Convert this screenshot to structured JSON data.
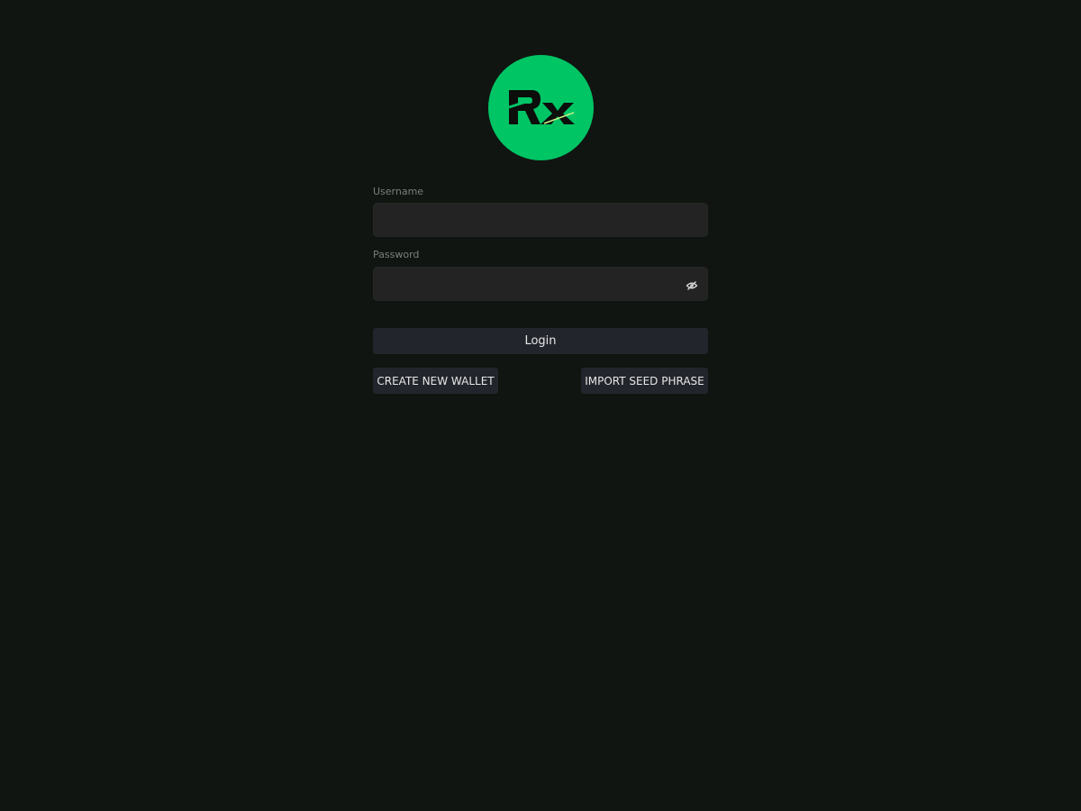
{
  "logo": {
    "text": "Rx",
    "color": "#00c565"
  },
  "form": {
    "username": {
      "label": "Username",
      "value": "",
      "placeholder": ""
    },
    "password": {
      "label": "Password",
      "value": "",
      "placeholder": "",
      "toggle_icon": "eye-slash-icon"
    },
    "login_label": "Login",
    "create_wallet_label": "CREATE NEW WALLET",
    "import_seed_label": "IMPORT SEED PHRASE"
  }
}
